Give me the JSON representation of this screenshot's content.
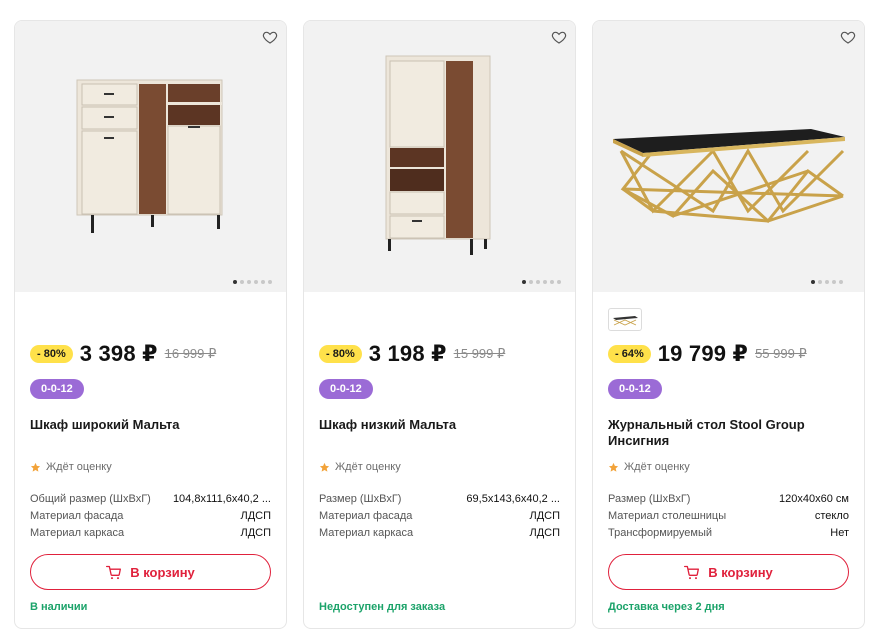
{
  "colors": {
    "accent": "#e0213c",
    "discount_badge": "#ffe14a",
    "promo_badge": "#9b6bd6",
    "stock_green": "#1ca36a",
    "rating_star": "#f2a33a"
  },
  "products": [
    {
      "image_icon": "sideboard-image",
      "discount": "- 80%",
      "price": "3 398 ₽",
      "old_price": "16 999 ₽",
      "promo": "0-0-12",
      "title": "Шкаф широкий Мальта",
      "rating_text": "Ждёт оценку",
      "specs": [
        {
          "key": "Общий размер (ШхВхГ)",
          "value": "104,8x111,6x40,2 ..."
        },
        {
          "key": "Материал фасада",
          "value": "ЛДСП"
        },
        {
          "key": "Материал каркаса",
          "value": "ЛДСП"
        }
      ],
      "cart_label": "В корзину",
      "stock": "В наличии"
    },
    {
      "image_icon": "cabinet-image",
      "discount": "- 80%",
      "price": "3 198 ₽",
      "old_price": "15 999 ₽",
      "promo": "0-0-12",
      "title": "Шкаф низкий Мальта",
      "rating_text": "Ждёт оценку",
      "specs": [
        {
          "key": "Размер (ШхВхГ)",
          "value": "69,5x143,6x40,2 ..."
        },
        {
          "key": "Материал фасада",
          "value": "ЛДСП"
        },
        {
          "key": "Материал каркаса",
          "value": "ЛДСП"
        }
      ],
      "stock": "Недоступен для заказа"
    },
    {
      "image_icon": "coffee-table-image",
      "discount": "- 64%",
      "price": "19 799 ₽",
      "old_price": "55 999 ₽",
      "promo": "0-0-12",
      "title": "Журнальный стол Stool Group Инсигния",
      "rating_text": "Ждёт оценку",
      "specs": [
        {
          "key": "Размер (ШхВхГ)",
          "value": "120x40x60 см"
        },
        {
          "key": "Материал столешницы",
          "value": "стекло"
        },
        {
          "key": "Трансформируемый",
          "value": "Нет"
        }
      ],
      "cart_label": "В корзину",
      "stock": "Доставка через 2 дня"
    }
  ]
}
